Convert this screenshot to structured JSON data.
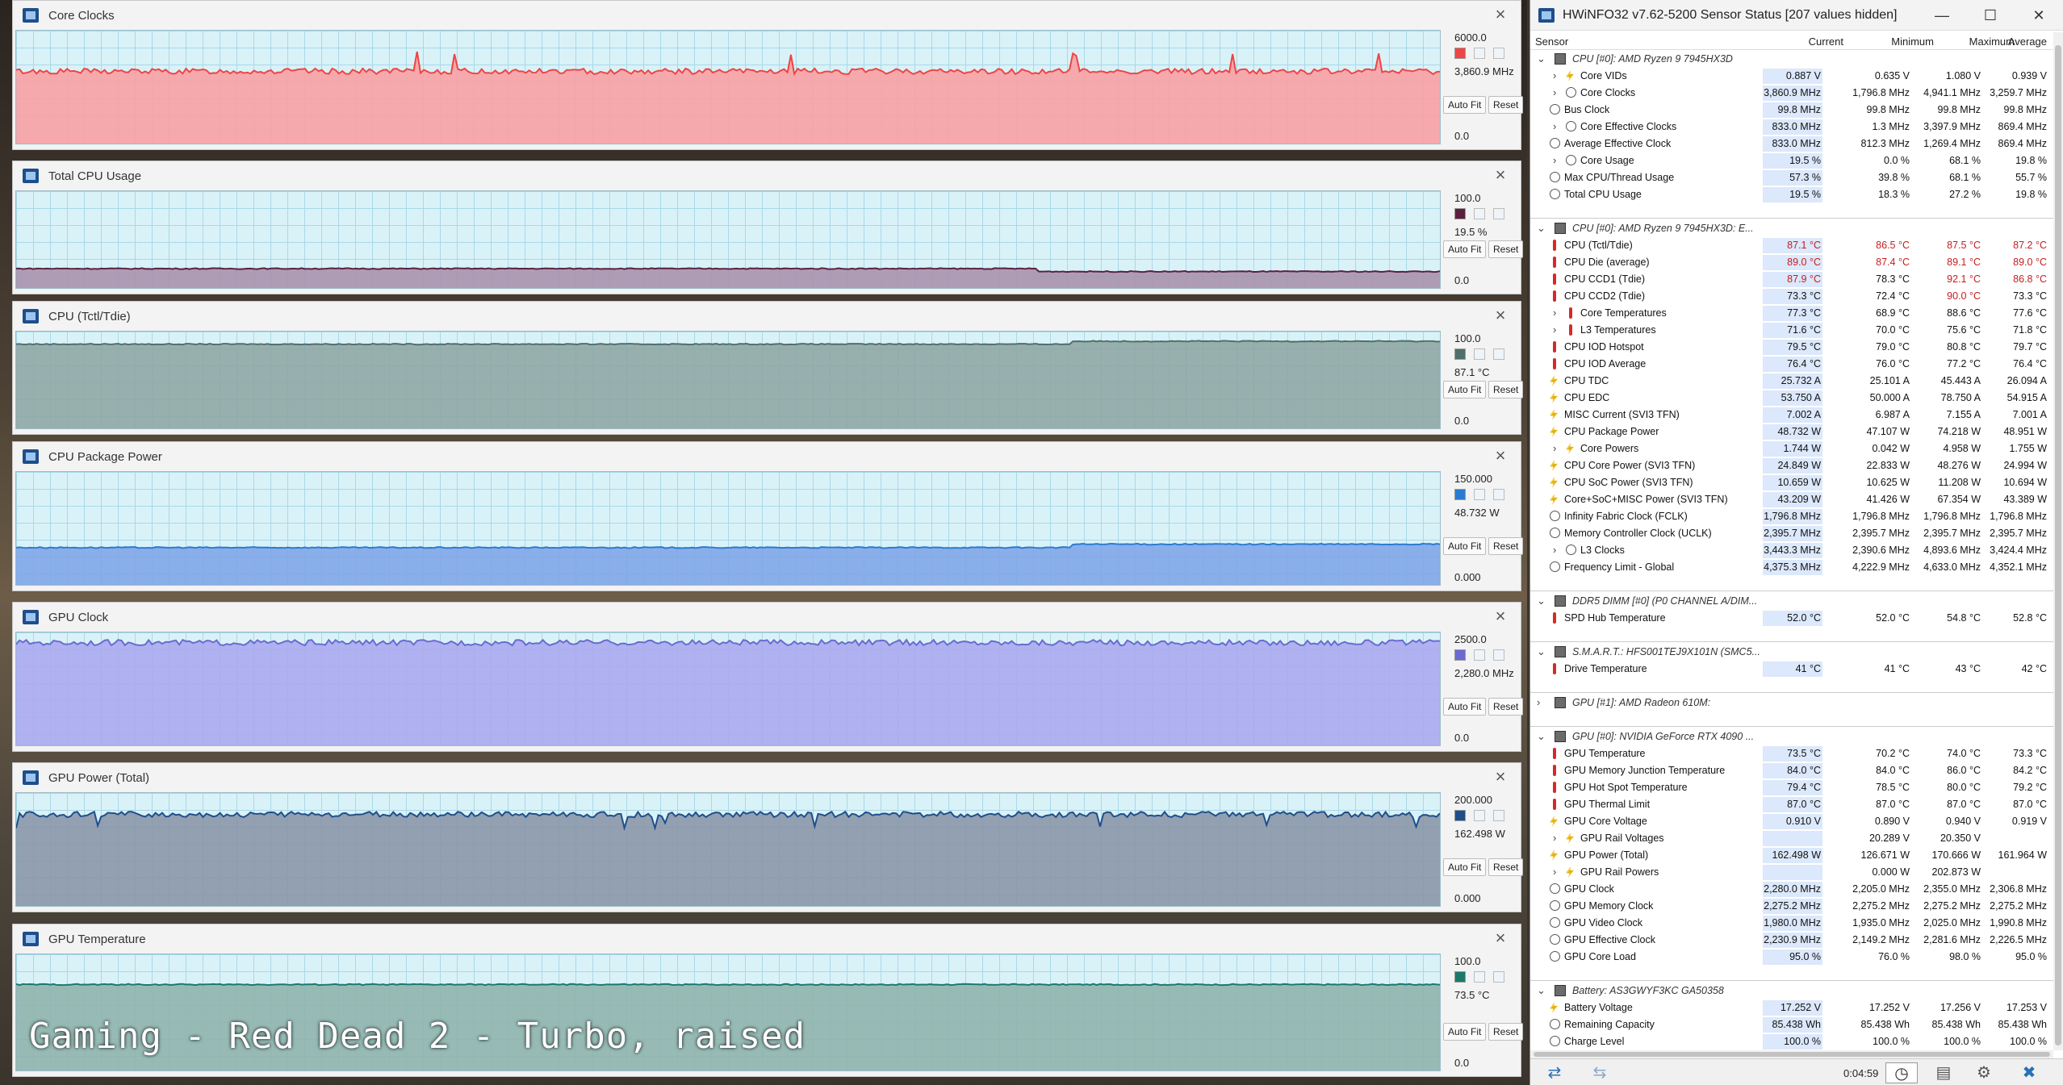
{
  "caption": "Gaming - Red Dead 2 - Turbo, raised",
  "graph_buttons": {
    "autofit": "Auto Fit",
    "reset": "Reset"
  },
  "graphs": [
    {
      "title": "Core Clocks",
      "max": "6000.0",
      "current": "3,860.9 MHz",
      "min": "0.0",
      "color": "#ef4444",
      "fill": "#f8a1a3",
      "level": 0.64,
      "height_class": "g1"
    },
    {
      "title": "Total CPU Usage",
      "max": "100.0",
      "current": "19.5 %",
      "min": "0.0",
      "color": "#5a2040",
      "fill": "#a992ac",
      "level": 0.2
    },
    {
      "title": "CPU (Tctl/Tdie)",
      "max": "100.0",
      "current": "87.1 °C",
      "min": "0.0",
      "color": "#4f6f6c",
      "fill": "#8fa7a4",
      "level": 0.87
    },
    {
      "title": "CPU Package Power",
      "max": "150.000",
      "current": "48.732 W",
      "min": "0.000",
      "color": "#2a7bd0",
      "fill": "#7fa6e8",
      "level": 0.33
    },
    {
      "title": "GPU Clock",
      "max": "2500.0",
      "current": "2,280.0 MHz",
      "min": "0.0",
      "color": "#6a6ad0",
      "fill": "#aaaaee",
      "level": 0.91
    },
    {
      "title": "GPU Power (Total)",
      "max": "200.000",
      "current": "162.498 W",
      "min": "0.000",
      "color": "#1f4e8a",
      "fill": "#8a97a8",
      "level": 0.81
    },
    {
      "title": "GPU Temperature",
      "max": "100.0",
      "current": "73.5 °C",
      "min": "0.0",
      "color": "#1a7a6a",
      "fill": "#8fb4ad",
      "level": 0.74
    }
  ],
  "hwinfo": {
    "title": "HWiNFO32 v7.62-5200 Sensor Status [207 values hidden]",
    "columns": {
      "sensor": "Sensor",
      "current": "Current",
      "minimum": "Minimum",
      "maximum": "Maximum",
      "average": "Average"
    },
    "rows": [
      {
        "type": "group",
        "label": "CPU [#0]: AMD Ryzen 9 7945HX3D"
      },
      {
        "icon": "bolt",
        "exp": true,
        "label": "Core VIDs",
        "cur": "0.887 V",
        "min": "0.635 V",
        "max": "1.080 V",
        "avg": "0.939 V"
      },
      {
        "icon": "clk",
        "exp": true,
        "label": "Core Clocks",
        "cur": "3,860.9 MHz",
        "min": "1,796.8 MHz",
        "max": "4,941.1 MHz",
        "avg": "3,259.7 MHz"
      },
      {
        "icon": "clk",
        "label": "Bus Clock",
        "cur": "99.8 MHz",
        "min": "99.8 MHz",
        "max": "99.8 MHz",
        "avg": "99.8 MHz"
      },
      {
        "icon": "clk",
        "exp": true,
        "label": "Core Effective Clocks",
        "cur": "833.0 MHz",
        "min": "1.3 MHz",
        "max": "3,397.9 MHz",
        "avg": "869.4 MHz"
      },
      {
        "icon": "clk",
        "label": "Average Effective Clock",
        "cur": "833.0 MHz",
        "min": "812.3 MHz",
        "max": "1,269.4 MHz",
        "avg": "869.4 MHz"
      },
      {
        "icon": "clk",
        "exp": true,
        "label": "Core Usage",
        "cur": "19.5 %",
        "min": "0.0 %",
        "max": "68.1 %",
        "avg": "19.8 %"
      },
      {
        "icon": "clk",
        "label": "Max CPU/Thread Usage",
        "cur": "57.3 %",
        "min": "39.8 %",
        "max": "68.1 %",
        "avg": "55.7 %"
      },
      {
        "icon": "clk",
        "label": "Total CPU Usage",
        "cur": "19.5 %",
        "min": "18.3 %",
        "max": "27.2 %",
        "avg": "19.8 %"
      },
      {
        "type": "spacer"
      },
      {
        "type": "group",
        "label": "CPU [#0]: AMD Ryzen 9 7945HX3D: E..."
      },
      {
        "icon": "therm",
        "label": "CPU (Tctl/Tdie)",
        "cur": "87.1 °C",
        "min": "86.5 °C",
        "max": "87.5 °C",
        "avg": "87.2 °C",
        "red": true
      },
      {
        "icon": "therm",
        "label": "CPU Die (average)",
        "cur": "89.0 °C",
        "min": "87.4 °C",
        "max": "89.1 °C",
        "avg": "89.0 °C",
        "red": true
      },
      {
        "icon": "therm",
        "label": "CPU CCD1 (Tdie)",
        "cur": "87.9 °C",
        "min": "78.3 °C",
        "max": "92.1 °C",
        "avg": "86.8 °C",
        "redcols": [
          0,
          2,
          3
        ]
      },
      {
        "icon": "therm",
        "label": "CPU CCD2 (Tdie)",
        "cur": "73.3 °C",
        "min": "72.4 °C",
        "max": "90.0 °C",
        "avg": "73.3 °C",
        "redcols": [
          2
        ]
      },
      {
        "icon": "therm",
        "exp": true,
        "label": "Core Temperatures",
        "cur": "77.3 °C",
        "min": "68.9 °C",
        "max": "88.6 °C",
        "avg": "77.6 °C"
      },
      {
        "icon": "therm",
        "exp": true,
        "label": "L3 Temperatures",
        "cur": "71.6 °C",
        "min": "70.0 °C",
        "max": "75.6 °C",
        "avg": "71.8 °C"
      },
      {
        "icon": "therm",
        "label": "CPU IOD Hotspot",
        "cur": "79.5 °C",
        "min": "79.0 °C",
        "max": "80.8 °C",
        "avg": "79.7 °C"
      },
      {
        "icon": "therm",
        "label": "CPU IOD Average",
        "cur": "76.4 °C",
        "min": "76.0 °C",
        "max": "77.2 °C",
        "avg": "76.4 °C"
      },
      {
        "icon": "bolt",
        "label": "CPU TDC",
        "cur": "25.732 A",
        "min": "25.101 A",
        "max": "45.443 A",
        "avg": "26.094 A"
      },
      {
        "icon": "bolt",
        "label": "CPU EDC",
        "cur": "53.750 A",
        "min": "50.000 A",
        "max": "78.750 A",
        "avg": "54.915 A"
      },
      {
        "icon": "bolt",
        "label": "MISC Current (SVI3 TFN)",
        "cur": "7.002 A",
        "min": "6.987 A",
        "max": "7.155 A",
        "avg": "7.001 A"
      },
      {
        "icon": "bolt",
        "label": "CPU Package Power",
        "cur": "48.732 W",
        "min": "47.107 W",
        "max": "74.218 W",
        "avg": "48.951 W"
      },
      {
        "icon": "bolt",
        "exp": true,
        "label": "Core Powers",
        "cur": "1.744 W",
        "min": "0.042 W",
        "max": "4.958 W",
        "avg": "1.755 W"
      },
      {
        "icon": "bolt",
        "label": "CPU Core Power (SVI3 TFN)",
        "cur": "24.849 W",
        "min": "22.833 W",
        "max": "48.276 W",
        "avg": "24.994 W"
      },
      {
        "icon": "bolt",
        "label": "CPU SoC Power (SVI3 TFN)",
        "cur": "10.659 W",
        "min": "10.625 W",
        "max": "11.208 W",
        "avg": "10.694 W"
      },
      {
        "icon": "bolt",
        "label": "Core+SoC+MISC Power (SVI3 TFN)",
        "cur": "43.209 W",
        "min": "41.426 W",
        "max": "67.354 W",
        "avg": "43.389 W"
      },
      {
        "icon": "clk",
        "label": "Infinity Fabric Clock (FCLK)",
        "cur": "1,796.8 MHz",
        "min": "1,796.8 MHz",
        "max": "1,796.8 MHz",
        "avg": "1,796.8 MHz"
      },
      {
        "icon": "clk",
        "label": "Memory Controller Clock (UCLK)",
        "cur": "2,395.7 MHz",
        "min": "2,395.7 MHz",
        "max": "2,395.7 MHz",
        "avg": "2,395.7 MHz"
      },
      {
        "icon": "clk",
        "exp": true,
        "label": "L3 Clocks",
        "cur": "3,443.3 MHz",
        "min": "2,390.6 MHz",
        "max": "4,893.6 MHz",
        "avg": "3,424.4 MHz"
      },
      {
        "icon": "clk",
        "label": "Frequency Limit - Global",
        "cur": "4,375.3 MHz",
        "min": "4,222.9 MHz",
        "max": "4,633.0 MHz",
        "avg": "4,352.1 MHz"
      },
      {
        "type": "spacer"
      },
      {
        "type": "group",
        "label": "DDR5 DIMM [#0] (P0 CHANNEL A/DIM..."
      },
      {
        "icon": "therm",
        "label": "SPD Hub Temperature",
        "cur": "52.0 °C",
        "min": "52.0 °C",
        "max": "54.8 °C",
        "avg": "52.8 °C"
      },
      {
        "type": "spacer"
      },
      {
        "type": "group",
        "label": "S.M.A.R.T.: HFS001TEJ9X101N (SMC5..."
      },
      {
        "icon": "therm",
        "label": "Drive Temperature",
        "cur": "41 °C",
        "min": "41 °C",
        "max": "43 °C",
        "avg": "42 °C"
      },
      {
        "type": "spacer"
      },
      {
        "type": "group",
        "label": "GPU [#1]: AMD Radeon 610M:",
        "collapsed": true
      },
      {
        "type": "spacer"
      },
      {
        "type": "group",
        "label": "GPU [#0]: NVIDIA GeForce RTX 4090 ..."
      },
      {
        "icon": "therm",
        "label": "GPU Temperature",
        "cur": "73.5 °C",
        "min": "70.2 °C",
        "max": "74.0 °C",
        "avg": "73.3 °C"
      },
      {
        "icon": "therm",
        "label": "GPU Memory Junction Temperature",
        "cur": "84.0 °C",
        "min": "84.0 °C",
        "max": "86.0 °C",
        "avg": "84.2 °C"
      },
      {
        "icon": "therm",
        "label": "GPU Hot Spot Temperature",
        "cur": "79.4 °C",
        "min": "78.5 °C",
        "max": "80.0 °C",
        "avg": "79.2 °C"
      },
      {
        "icon": "therm",
        "label": "GPU Thermal Limit",
        "cur": "87.0 °C",
        "min": "87.0 °C",
        "max": "87.0 °C",
        "avg": "87.0 °C"
      },
      {
        "icon": "bolt",
        "label": "GPU Core Voltage",
        "cur": "0.910 V",
        "min": "0.890 V",
        "max": "0.940 V",
        "avg": "0.919 V"
      },
      {
        "icon": "bolt",
        "exp": true,
        "label": "GPU Rail Voltages",
        "cur": "",
        "min": "20.289 V",
        "max": "20.350 V",
        "avg": ""
      },
      {
        "icon": "bolt",
        "label": "GPU Power (Total)",
        "cur": "162.498 W",
        "min": "126.671 W",
        "max": "170.666 W",
        "avg": "161.964 W"
      },
      {
        "icon": "bolt",
        "exp": true,
        "label": "GPU Rail Powers",
        "cur": "",
        "min": "0.000 W",
        "max": "202.873 W",
        "avg": ""
      },
      {
        "icon": "clk",
        "label": "GPU Clock",
        "cur": "2,280.0 MHz",
        "min": "2,205.0 MHz",
        "max": "2,355.0 MHz",
        "avg": "2,306.8 MHz"
      },
      {
        "icon": "clk",
        "label": "GPU Memory Clock",
        "cur": "2,275.2 MHz",
        "min": "2,275.2 MHz",
        "max": "2,275.2 MHz",
        "avg": "2,275.2 MHz"
      },
      {
        "icon": "clk",
        "label": "GPU Video Clock",
        "cur": "1,980.0 MHz",
        "min": "1,935.0 MHz",
        "max": "2,025.0 MHz",
        "avg": "1,990.8 MHz"
      },
      {
        "icon": "clk",
        "label": "GPU Effective Clock",
        "cur": "2,230.9 MHz",
        "min": "2,149.2 MHz",
        "max": "2,281.6 MHz",
        "avg": "2,226.5 MHz"
      },
      {
        "icon": "clk",
        "label": "GPU Core Load",
        "cur": "95.0 %",
        "min": "76.0 %",
        "max": "98.0 %",
        "avg": "95.0 %"
      },
      {
        "type": "spacer"
      },
      {
        "type": "group",
        "label": "Battery: AS3GWYF3KC GA50358"
      },
      {
        "icon": "bolt",
        "label": "Battery Voltage",
        "cur": "17.252 V",
        "min": "17.252 V",
        "max": "17.256 V",
        "avg": "17.253 V"
      },
      {
        "icon": "clk",
        "label": "Remaining Capacity",
        "cur": "85.438 Wh",
        "min": "85.438 Wh",
        "max": "85.438 Wh",
        "avg": "85.438 Wh"
      },
      {
        "icon": "clk",
        "label": "Charge Level",
        "cur": "100.0 %",
        "min": "100.0 %",
        "max": "100.0 %",
        "avg": "100.0 %"
      }
    ],
    "timer": "0:04:59"
  }
}
